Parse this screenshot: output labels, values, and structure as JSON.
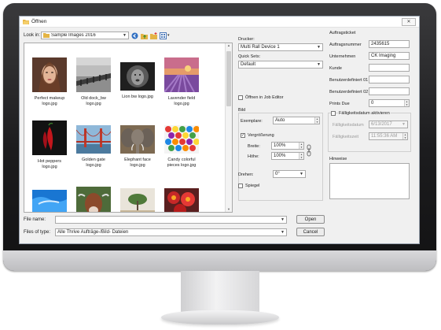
{
  "window": {
    "title": "Öffnen",
    "close_symbol": "✕"
  },
  "left": {
    "look_in_label": "Look in:",
    "look_in_value": "Sample Images 2016",
    "files": [
      {
        "name": "Perfect makeup logo.jpg",
        "line1": "Perfect makeup",
        "line2": "logo.jpg"
      },
      {
        "name": "Old dock_bw logo.jpg",
        "line1": "Old dock_bw",
        "line2": "logo.jpg"
      },
      {
        "name": "Lion bw logo.jpg",
        "line1": "Lion bw logo.jpg",
        "line2": ""
      },
      {
        "name": "Lavender field logo.jpg",
        "line1": "Lavender field",
        "line2": "logo.jpg"
      },
      {
        "name": "Hot peppers logo.jpg",
        "line1": "Hot peppers",
        "line2": "logo.jpg"
      },
      {
        "name": "Golden gate logo.jpg",
        "line1": "Golden gate",
        "line2": "logo.jpg"
      },
      {
        "name": "Elephant face logo.jpg",
        "line1": "Elephant face",
        "line2": "logo.jpg"
      },
      {
        "name": "Candy colorful pieces logo.jpg",
        "line1": "Candy colorful",
        "line2": "pieces logo.jpg"
      },
      {
        "name": "",
        "line1": "",
        "line2": ""
      },
      {
        "name": "",
        "line1": "",
        "line2": ""
      },
      {
        "name": "",
        "line1": "",
        "line2": ""
      },
      {
        "name": "",
        "line1": "",
        "line2": ""
      }
    ],
    "file_name_label": "File name:",
    "file_name_value": "",
    "files_of_type_label": "Files of type:",
    "files_of_type_value": "Alle Thrive Aufträge-/Bild- Dateien",
    "open_label": "Open",
    "cancel_label": "Cancel"
  },
  "middle": {
    "printer_label": "Drucker:",
    "printer_value": "Multi Rall Device 1",
    "queue_label": "Quick Sets:",
    "queue_value": "Default",
    "open_in_job_editor_label": "Öffnen in Job Editor",
    "image_group_label": "Bild",
    "copies_label": "Exemplare:",
    "copies_value": "Auto",
    "scaling_label": "Vergrößerung",
    "scaling_checked": "✓",
    "width_label": "Breite:",
    "width_value": "100%",
    "height_label": "Höhe:",
    "height_value": "100%",
    "rotate_label": "Drehen:",
    "rotate_value": "0°",
    "mirror_label": "Spiegel"
  },
  "right": {
    "group_label": "Auftragsticket",
    "order_number_label": "Auftragsnummer",
    "order_number_value": "2435615",
    "company_label": "Unternehmen",
    "company_value": "CK Imaging",
    "customer_label": "Kunde",
    "customer_value": "",
    "user_defined_1_label": "Benutzerdefiniert 01",
    "user_defined_2_label": "Benutzerdefiniert 02",
    "prints_due_label": "Prints Due",
    "prints_due_value": "0",
    "due_date_enable_label": "Fälligkeitsdatum aktivieren",
    "due_date_label": "Fälligkeitsdatum",
    "due_date_value": "6/13/2017",
    "due_time_label": "Fälligkeitszeit",
    "due_time_value": "11:55:36 AM",
    "notes_label": "Hinweise"
  },
  "colors": {
    "window_bg": "#f0f0f0",
    "bezel": "#1c1c1e",
    "field_border": "#a9a9a9"
  }
}
